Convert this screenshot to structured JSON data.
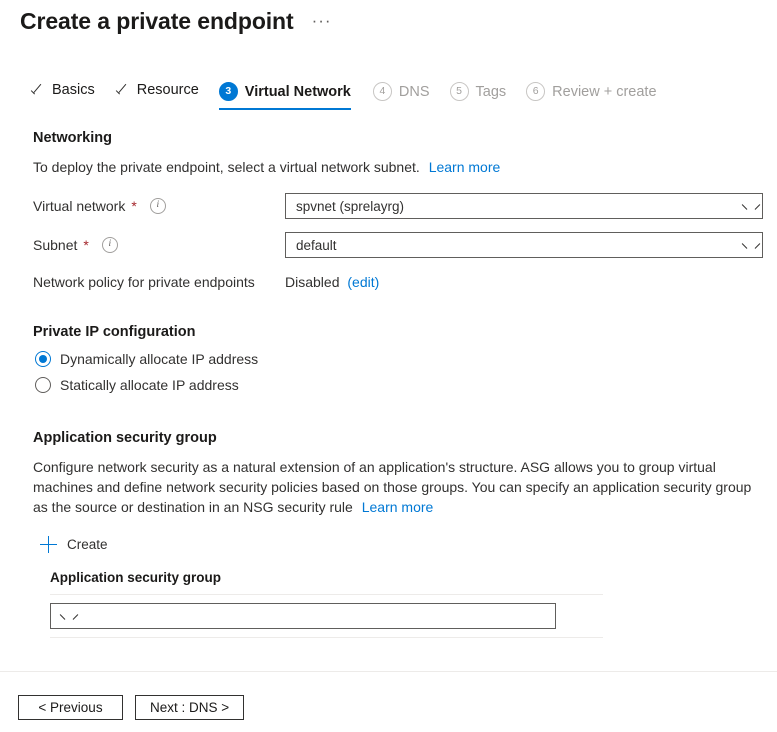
{
  "header": {
    "title": "Create a private endpoint",
    "more_menu": "···"
  },
  "wizard": {
    "tabs": [
      {
        "label": "Basics",
        "state": "done",
        "marker": "check"
      },
      {
        "label": "Resource",
        "state": "done",
        "marker": "check"
      },
      {
        "label": "Virtual Network",
        "state": "active",
        "marker": "3"
      },
      {
        "label": "DNS",
        "state": "disabled",
        "marker": "4"
      },
      {
        "label": "Tags",
        "state": "disabled",
        "marker": "5"
      },
      {
        "label": "Review + create",
        "state": "disabled",
        "marker": "6"
      }
    ]
  },
  "networking": {
    "heading": "Networking",
    "description": "To deploy the private endpoint, select a virtual network subnet.",
    "learn_more": "Learn more",
    "virtual_network": {
      "label": "Virtual network",
      "required_marker": "*",
      "value": "spvnet (sprelayrg)"
    },
    "subnet": {
      "label": "Subnet",
      "required_marker": "*",
      "value": "default"
    },
    "network_policy": {
      "label": "Network policy for private endpoints",
      "value": "Disabled",
      "edit_link": "(edit)"
    }
  },
  "private_ip": {
    "heading": "Private IP configuration",
    "options": [
      {
        "label": "Dynamically allocate IP address",
        "selected": true
      },
      {
        "label": "Statically allocate IP address",
        "selected": false
      }
    ]
  },
  "asg": {
    "heading": "Application security group",
    "description": "Configure network security as a natural extension of an application's structure. ASG allows you to group virtual machines and define network security policies based on those groups. You can specify an application security group as the source or destination in an NSG security rule",
    "learn_more": "Learn more",
    "create_label": "Create",
    "column_header": "Application security group",
    "select_value": ""
  },
  "footer": {
    "previous_label": "< Previous",
    "next_label": "Next : DNS >"
  },
  "colors": {
    "accent": "#0078d4",
    "link": "#0078d4",
    "required": "#a4262c",
    "disabled_text": "#a19f9d",
    "text": "#1b1a19",
    "divider": "#edebe9"
  }
}
